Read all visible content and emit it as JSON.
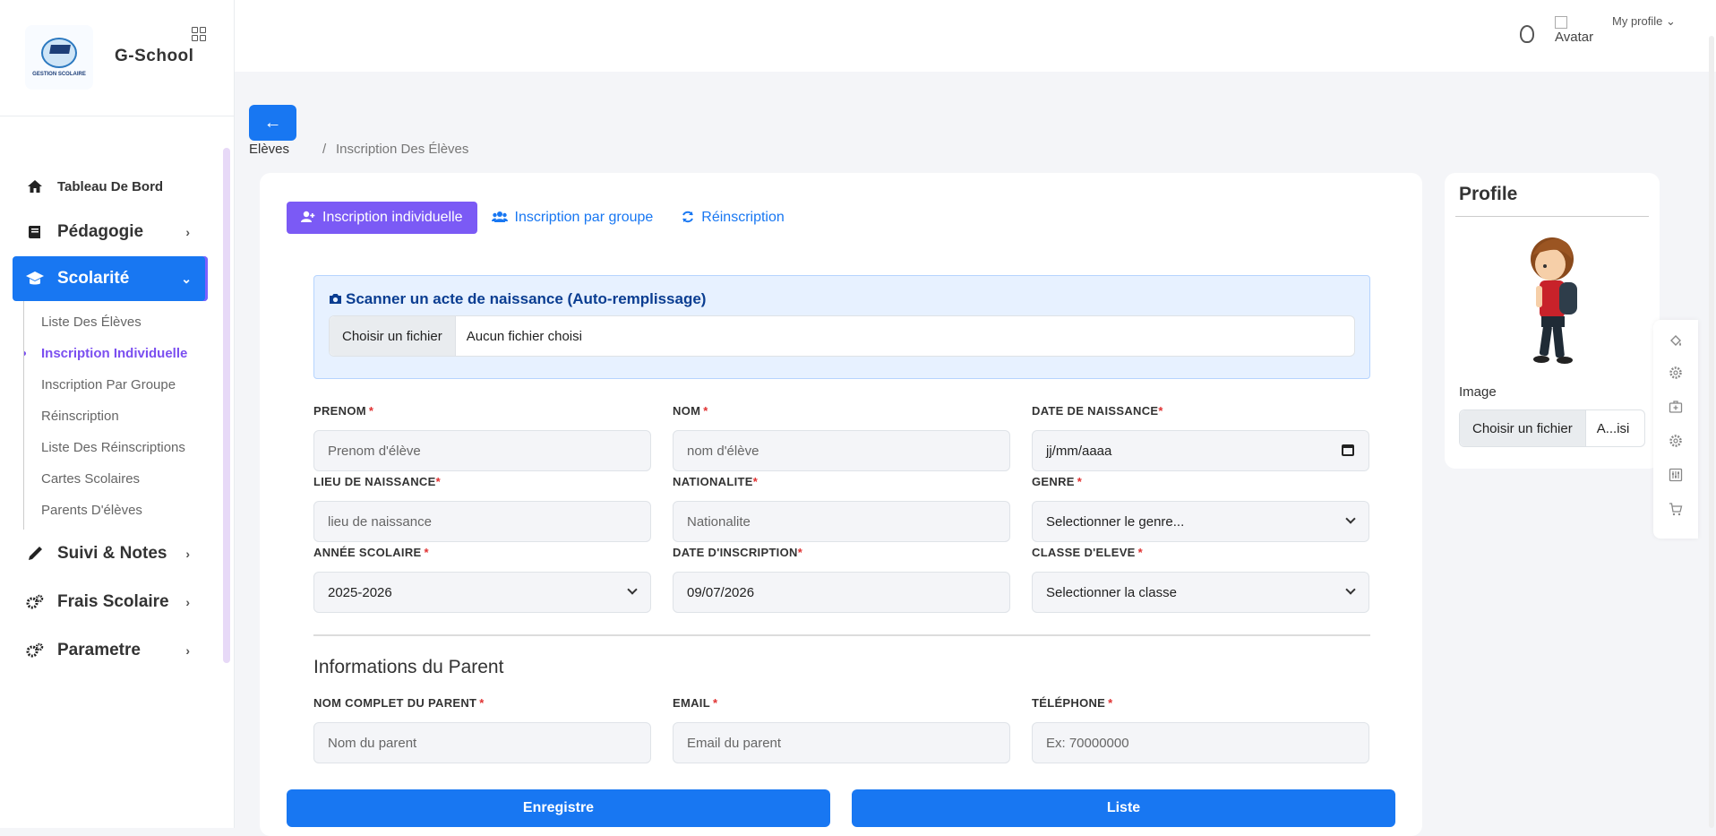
{
  "brand": {
    "name": "G-School",
    "logo_text": "GESTION SCOLAIRE"
  },
  "sidebar": {
    "items": [
      {
        "label": "Tableau De Bord"
      },
      {
        "label": "Pédagogie"
      },
      {
        "label": "Scolarité"
      },
      {
        "label": "Suivi & Notes"
      },
      {
        "label": "Frais Scolaire"
      },
      {
        "label": "Parametre"
      }
    ],
    "sub_items": [
      {
        "label": "Liste Des Élèves"
      },
      {
        "label": "Inscription Individuelle"
      },
      {
        "label": "Inscription Par Groupe"
      },
      {
        "label": "Réinscription"
      },
      {
        "label": "Liste Des Réinscriptions"
      },
      {
        "label": "Cartes Scolaires"
      },
      {
        "label": "Parents D'élèves"
      }
    ]
  },
  "topbar": {
    "avatar_alt": "Avatar",
    "profile_link": "My profile ⌄"
  },
  "back_icon": "←",
  "breadcrumb": {
    "parent": "Elèves",
    "separator": "/",
    "current": "Inscription Des Élèves"
  },
  "tabs": [
    {
      "label": "Inscription individuelle",
      "icon": "user-plus-icon"
    },
    {
      "label": "Inscription par groupe",
      "icon": "users-icon"
    },
    {
      "label": "Réinscription",
      "icon": "refresh-icon"
    }
  ],
  "scan": {
    "title": "Scanner un acte de naissance (Auto-remplissage)",
    "file_button": "Choisir un fichier",
    "file_name": "Aucun fichier choisi"
  },
  "form": {
    "prenom": {
      "label": "PRENOM",
      "placeholder": "Prenom d'élève"
    },
    "nom": {
      "label": "NOM",
      "placeholder": "nom d'élève"
    },
    "date_naissance": {
      "label": "DATE DE NAISSANCE",
      "placeholder": "jj/mm/aaaa"
    },
    "lieu_naissance": {
      "label": "LIEU DE NAISSANCE",
      "placeholder": "lieu de naissance"
    },
    "nationalite": {
      "label": "NATIONALITE",
      "placeholder": "Nationalite"
    },
    "genre": {
      "label": "GENRE",
      "value": "Selectionner le genre..."
    },
    "annee_scolaire": {
      "label": "ANNÉE SCOLAIRE",
      "value": "2025-2026"
    },
    "date_inscription": {
      "label": "DATE D'INSCRIPTION",
      "value": "09/07/2026"
    },
    "classe": {
      "label": "CLASSE D'ELEVE",
      "value": "Selectionner la classe"
    },
    "required_mark": "*"
  },
  "parent_section": {
    "title": "Informations du Parent",
    "nom": {
      "label": "NOM COMPLET DU PARENT",
      "placeholder": "Nom du parent"
    },
    "email": {
      "label": "EMAIL",
      "placeholder": "Email du parent"
    },
    "telephone": {
      "label": "TÉLÉPHONE",
      "placeholder": "Ex: 70000000"
    }
  },
  "buttons": {
    "save": "Enregistre",
    "list": "Liste"
  },
  "profile": {
    "title": "Profile",
    "image_label": "Image",
    "file_button": "Choisir un fichier",
    "file_name": "A...isi"
  },
  "colors": {
    "primary": "#1877f2",
    "purple": "#7b5af5",
    "required": "#e03131"
  }
}
